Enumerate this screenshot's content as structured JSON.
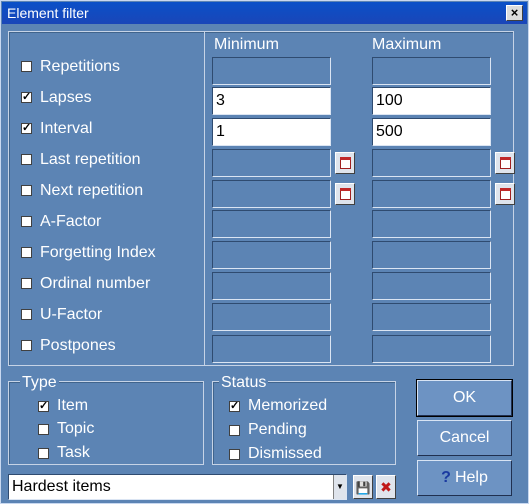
{
  "window": {
    "title": "Element filter",
    "close_glyph": "×"
  },
  "headers": {
    "minimum": "Minimum",
    "maximum": "Maximum"
  },
  "criteria": [
    {
      "label": "Repetitions",
      "checked": false,
      "min": "",
      "max": "",
      "calendar": false
    },
    {
      "label": "Lapses",
      "checked": true,
      "min": "3",
      "max": "100",
      "calendar": false
    },
    {
      "label": "Interval",
      "checked": true,
      "min": "1",
      "max": "500",
      "calendar": false
    },
    {
      "label": "Last repetition",
      "checked": false,
      "min": "",
      "max": "",
      "calendar": true
    },
    {
      "label": "Next repetition",
      "checked": false,
      "min": "",
      "max": "",
      "calendar": true
    },
    {
      "label": "A-Factor",
      "checked": false,
      "min": "",
      "max": "",
      "calendar": false
    },
    {
      "label": "Forgetting Index",
      "checked": false,
      "min": "",
      "max": "",
      "calendar": false
    },
    {
      "label": "Ordinal number",
      "checked": false,
      "min": "",
      "max": "",
      "calendar": false
    },
    {
      "label": "U-Factor",
      "checked": false,
      "min": "",
      "max": "",
      "calendar": false
    },
    {
      "label": "Postpones",
      "checked": false,
      "min": "",
      "max": "",
      "calendar": false
    }
  ],
  "type_group": {
    "title": "Type",
    "options": [
      {
        "label": "Item",
        "checked": true
      },
      {
        "label": "Topic",
        "checked": false
      },
      {
        "label": "Task",
        "checked": false
      }
    ]
  },
  "status_group": {
    "title": "Status",
    "options": [
      {
        "label": "Memorized",
        "checked": true
      },
      {
        "label": "Pending",
        "checked": false
      },
      {
        "label": "Dismissed",
        "checked": false
      }
    ]
  },
  "buttons": {
    "ok": "OK",
    "cancel": "Cancel",
    "help": "Help",
    "help_glyph": "?"
  },
  "filter_combo": {
    "value": "Hardest items",
    "arrow_glyph": "▼"
  },
  "filter_actions": {
    "save_glyph": "💾",
    "delete_glyph": "✖"
  },
  "check_glyph": "✓",
  "colors": {
    "dialog_bg": "#5c84b4",
    "title_bar": "#0a50c8",
    "field_active": "#ffffff"
  }
}
